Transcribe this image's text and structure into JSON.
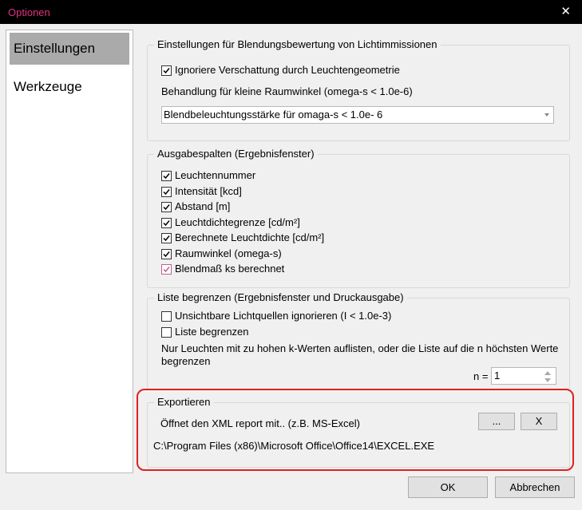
{
  "window": {
    "title": "Optionen",
    "title_color": "#e0337f",
    "close_glyph": "✕"
  },
  "nav": {
    "items": [
      {
        "label": "Einstellungen",
        "selected": true
      },
      {
        "label": "Werkzeuge",
        "selected": false
      }
    ]
  },
  "glare": {
    "legend": "Einstellungen für Blendungsbewertung von Lichtimmissionen",
    "ignore_shading": {
      "label": "Ignoriere Verschattung durch Leuchtengeometrie",
      "checked": true
    },
    "small_angle_label": "Behandlung für kleine Raumwinkel (omega-s < 1.0e-6)",
    "small_angle_value": "Blendbeleuchtungsstärke für omaga-s < 1.0e- 6"
  },
  "output": {
    "legend": "Ausgabespalten (Ergebnisfenster)",
    "columns": [
      {
        "label": "Leuchtennummer",
        "checked": true
      },
      {
        "label": "Intensität [kcd]",
        "checked": true
      },
      {
        "label": "Abstand [m]",
        "checked": true
      },
      {
        "label": "Leuchtdichtegrenze [cd/m²]",
        "checked": true
      },
      {
        "label": "Berechnete Leuchtdichte [cd/m²]",
        "checked": true
      },
      {
        "label": "Raumwinkel (omega-s)",
        "checked": true
      },
      {
        "label": "Blendmaß ks berechnet",
        "checked": true
      }
    ]
  },
  "limit": {
    "legend": "Liste begrenzen (Ergebnisfenster und Druckausgabe)",
    "ignore_invisible": {
      "label": "Unsichtbare Lichtquellen ignorieren (I < 1.0e-3)",
      "checked": false
    },
    "limit_list": {
      "label": "Liste begrenzen",
      "checked": false
    },
    "description_line1": "Nur Leuchten mit zu hohen k-Werten auflisten, oder die Liste auf die n höchsten Werte",
    "description_line2": "begrenzen",
    "n_label": "n =",
    "n_value": "1"
  },
  "export": {
    "legend": "Exportieren",
    "label": "Öffnet den XML report mit.. (z.B. MS-Excel)",
    "browse_label": "...",
    "clear_label": "X",
    "path": "C:\\Program Files (x86)\\Microsoft Office\\Office14\\EXCEL.EXE",
    "highlight_color": "#e02020"
  },
  "footer": {
    "ok_label": "OK",
    "cancel_label": "Abbrechen"
  }
}
